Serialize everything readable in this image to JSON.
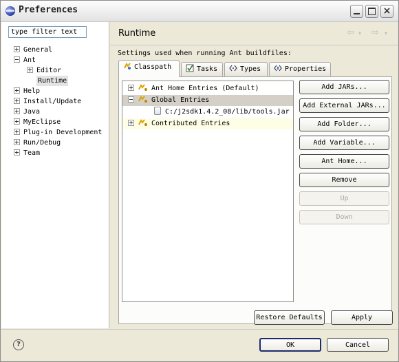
{
  "window": {
    "title": "Preferences",
    "close_glyph": "×"
  },
  "filter": {
    "placeholder": "type filter text"
  },
  "tree": [
    {
      "label": "General",
      "expander": "plus"
    },
    {
      "label": "Ant",
      "expander": "minus"
    },
    {
      "label": "Editor",
      "expander": "plus"
    },
    {
      "label": "Runtime",
      "expander": "none",
      "selected": true
    },
    {
      "label": "Help",
      "expander": "plus"
    },
    {
      "label": "Install/Update",
      "expander": "plus"
    },
    {
      "label": "Java",
      "expander": "plus"
    },
    {
      "label": "MyEclipse",
      "expander": "plus"
    },
    {
      "label": "Plug-in Development",
      "expander": "plus"
    },
    {
      "label": "Run/Debug",
      "expander": "plus"
    },
    {
      "label": "Team",
      "expander": "plus"
    }
  ],
  "page": {
    "title": "Runtime",
    "description": "Settings used when running Ant buildfiles:",
    "nav_back_icon": "back-arrow-icon",
    "nav_forward_icon": "forward-arrow-icon"
  },
  "tabs": [
    {
      "label": "Classpath",
      "icon": "classpath-icon",
      "active": true
    },
    {
      "label": "Tasks",
      "icon": "tasks-icon",
      "active": false
    },
    {
      "label": "Types",
      "icon": "types-icon",
      "active": false
    },
    {
      "label": "Properties",
      "icon": "properties-icon",
      "active": false
    }
  ],
  "classpath": {
    "entries": [
      {
        "label": "Ant Home Entries (Default)",
        "expander": "plus"
      },
      {
        "label": "Global Entries",
        "expander": "minus",
        "highlighted": true
      },
      {
        "label": "C:/j2sdk1.4.2_08/lib/tools.jar",
        "expander": "none"
      },
      {
        "label": "Contributed Entries",
        "expander": "plus"
      }
    ]
  },
  "buttons": {
    "add_jars": "Add JARs...",
    "add_external_jars": "Add External JARs...",
    "add_folder": "Add Folder...",
    "add_variable": "Add Variable...",
    "ant_home": "Ant Home...",
    "remove": "Remove",
    "up": "Up",
    "down": "Down",
    "restore_defaults": "Restore Defaults",
    "apply": "Apply",
    "ok": "OK",
    "cancel": "Cancel"
  },
  "colors": {
    "accent": "#1c2c6c",
    "highlight_row": "#d4d0c8"
  }
}
